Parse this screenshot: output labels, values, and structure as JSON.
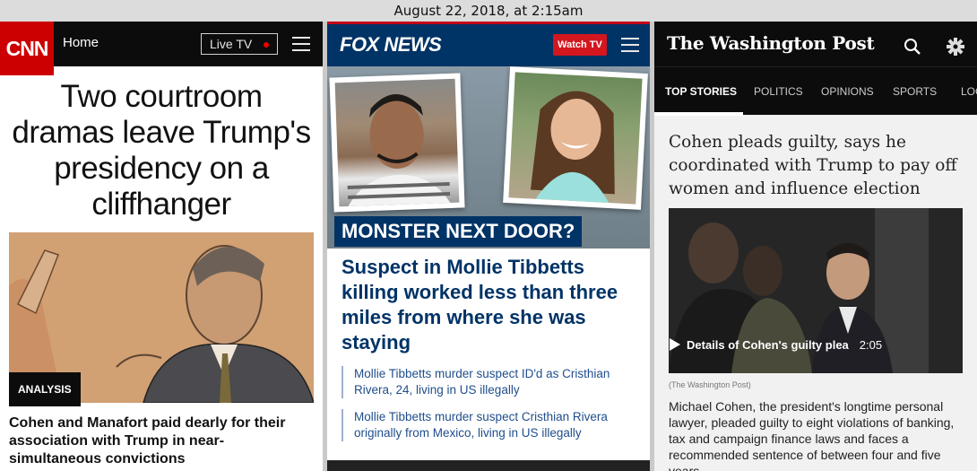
{
  "statusbar": {
    "timestamp": "August 22, 2018, at 2:15am"
  },
  "cnn": {
    "logo": "CNN",
    "nav_home": "Home",
    "live_tv": "Live TV",
    "headline": "Two courtroom dramas leave Trump's presidency on a cliffhanger",
    "badge": "ANALYSIS",
    "subheadline": "Cohen and Manafort paid dearly for their association with Trump in near-simultaneous convictions",
    "colors": {
      "brand": "#cc0000",
      "header": "#0c0c0c"
    }
  },
  "fox": {
    "logo": "FOX NEWS",
    "watch_tv": "Watch TV",
    "kicker": "MONSTER NEXT DOOR?",
    "headline": "Suspect in Mollie Tibbetts killing worked less than three miles from where she was staying",
    "related": [
      "Mollie Tibbetts murder suspect ID'd as Cristhian Rivera, 24, living in US illegally",
      "Mollie Tibbetts murder suspect Cristhian Rivera originally from Mexico, living in US illegally"
    ],
    "colors": {
      "brand": "#003366",
      "accent": "#d4161e"
    }
  },
  "wapo": {
    "logo": "The Washington Post",
    "tabs": [
      "TOP STORIES",
      "POLITICS",
      "OPINIONS",
      "SPORTS",
      "LOC"
    ],
    "headline": "Cohen pleads guilty, says he coordinated with Trump to pay off women and influence election",
    "video_label": "Details of Cohen's guilty plea",
    "video_duration": "2:05",
    "credit": "(The Washington Post)",
    "body": "Michael Cohen, the president's longtime personal lawyer, pleaded guilty to eight violations of banking, tax and campaign finance laws and faces a recommended sentence of between four and five years"
  }
}
